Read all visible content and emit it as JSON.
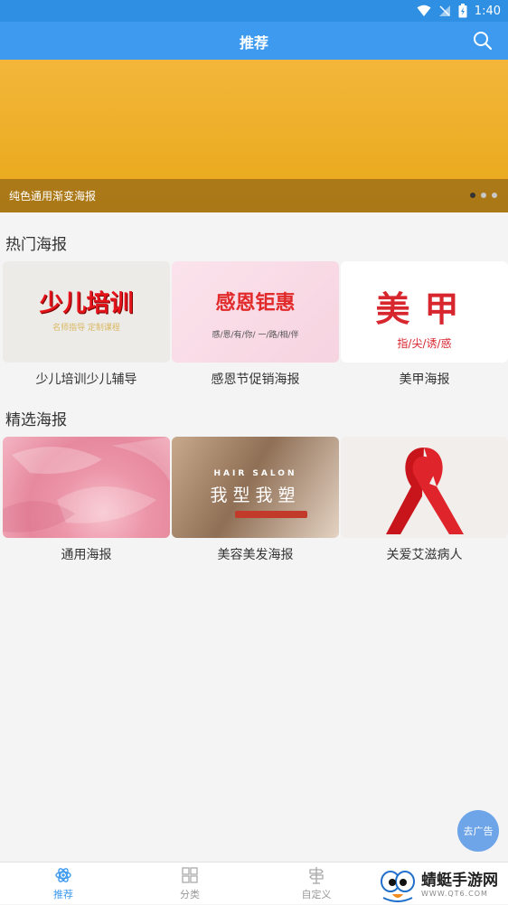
{
  "status_bar": {
    "time": "1:40"
  },
  "header": {
    "title": "推荐"
  },
  "banner": {
    "caption": "纯色通用渐变海报",
    "page_count": 3,
    "active_page": 1
  },
  "hot_section": {
    "title": "热门海报",
    "items": [
      {
        "label": "少儿培训少儿辅导",
        "thumb_title": "少儿培训",
        "thumb_subtitle": "名师指导 定制课程"
      },
      {
        "label": "感恩节促销海报",
        "thumb_title": "感恩钜惠",
        "thumb_subtitle": "感/恩/有/你/ 一/路/相/伴"
      },
      {
        "label": "美甲海报",
        "thumb_title": "美甲",
        "thumb_subtitle": "指/尖/诱/惑"
      }
    ]
  },
  "featured_section": {
    "title": "精选海报",
    "items": [
      {
        "label": "通用海报"
      },
      {
        "label": "美容美发海报",
        "thumb_en": "HAIR SALON",
        "thumb_title": "我型我塑"
      },
      {
        "label": "关爱艾滋病人"
      }
    ]
  },
  "fab": {
    "label": "去广告"
  },
  "tabs": [
    {
      "label": "推荐",
      "icon": "atom-icon",
      "active": true
    },
    {
      "label": "分类",
      "icon": "grid-icon",
      "active": false
    },
    {
      "label": "自定义",
      "icon": "signpost-icon",
      "active": false
    }
  ],
  "watermark": {
    "title": "蜻蜓手游网",
    "url": "WWW.QT6.COM"
  },
  "colors": {
    "primary": "#3d9aee",
    "status_bar": "#2f8fe3",
    "banner_top": "#f4b63a",
    "banner_bottom": "#e7a818"
  }
}
